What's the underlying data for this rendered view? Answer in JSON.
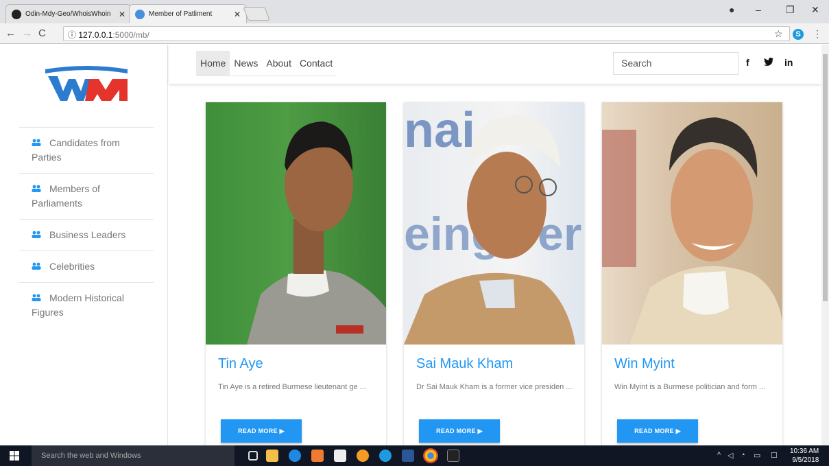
{
  "browser": {
    "tabs": [
      {
        "title": "Odin-Mdy-Geo/WhoisWhoin",
        "active": false
      },
      {
        "title": "Member of Patliment",
        "active": true
      }
    ],
    "url_host": "127.0.0.1",
    "url_path": ":5000/mb/"
  },
  "sidebar": {
    "items": [
      {
        "label_a": "Candidates from",
        "label_b": "Parties"
      },
      {
        "label_a": "Members of",
        "label_b": "Parliaments"
      },
      {
        "label_a": "Business Leaders",
        "label_b": ""
      },
      {
        "label_a": "Celebrities",
        "label_b": ""
      },
      {
        "label_a": "Modern Historical",
        "label_b": "Figures"
      }
    ]
  },
  "nav": {
    "links": [
      "Home",
      "News",
      "About",
      "Contact"
    ],
    "search_placeholder": "Search",
    "social": [
      "f",
      "in"
    ]
  },
  "cards": [
    {
      "name": "Tin Aye",
      "desc": "Tin Aye is a retired Burmese lieutenant ge ...",
      "button": "READ MORE"
    },
    {
      "name": "Sai Mauk Kham",
      "desc": "Dr Sai Mauk Kham is a former vice presiden ...",
      "button": "READ MORE"
    },
    {
      "name": "Win Myint",
      "desc": "Win Myint is a Burmese politician and form ...",
      "button": "READ MORE"
    }
  ],
  "taskbar": {
    "search_placeholder": "Search the web and Windows",
    "time": "10:36 AM",
    "date": "9/5/2018"
  },
  "colors": {
    "accent": "#2196f3",
    "taskbar": "#101623"
  }
}
